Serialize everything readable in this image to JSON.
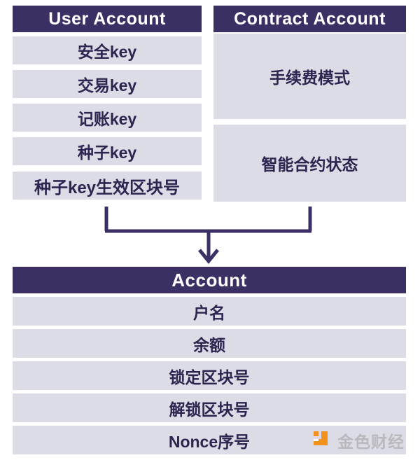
{
  "colors": {
    "header_bg": "#3b2f63",
    "header_text": "#ffffff",
    "row_bg": "#dcdce6",
    "row_text": "#2d2550",
    "connector": "#3b2f63",
    "page_bg": "#ffffff",
    "watermark_logo": "#f2921d",
    "watermark_text": "#b9b9bd"
  },
  "user_account": {
    "title": "User Account",
    "rows": [
      {
        "label": "安全key"
      },
      {
        "label": "交易key"
      },
      {
        "label": "记账key"
      },
      {
        "label": "种子key"
      },
      {
        "label": "种子key生效区块号"
      }
    ]
  },
  "contract_account": {
    "title": "Contract Account",
    "rows": [
      {
        "label": "手续费模式"
      },
      {
        "label": "智能合约状态"
      }
    ]
  },
  "connector": {
    "name": "merge-arrow",
    "direction": "down"
  },
  "account": {
    "title": "Account",
    "rows": [
      {
        "label": "户名"
      },
      {
        "label": "余额"
      },
      {
        "label": "锁定区块号"
      },
      {
        "label": "解锁区块号"
      },
      {
        "label": "Nonce序号"
      }
    ]
  },
  "watermark": {
    "logo_icon": "jinse-bracket-icon",
    "text": "金色财经"
  }
}
